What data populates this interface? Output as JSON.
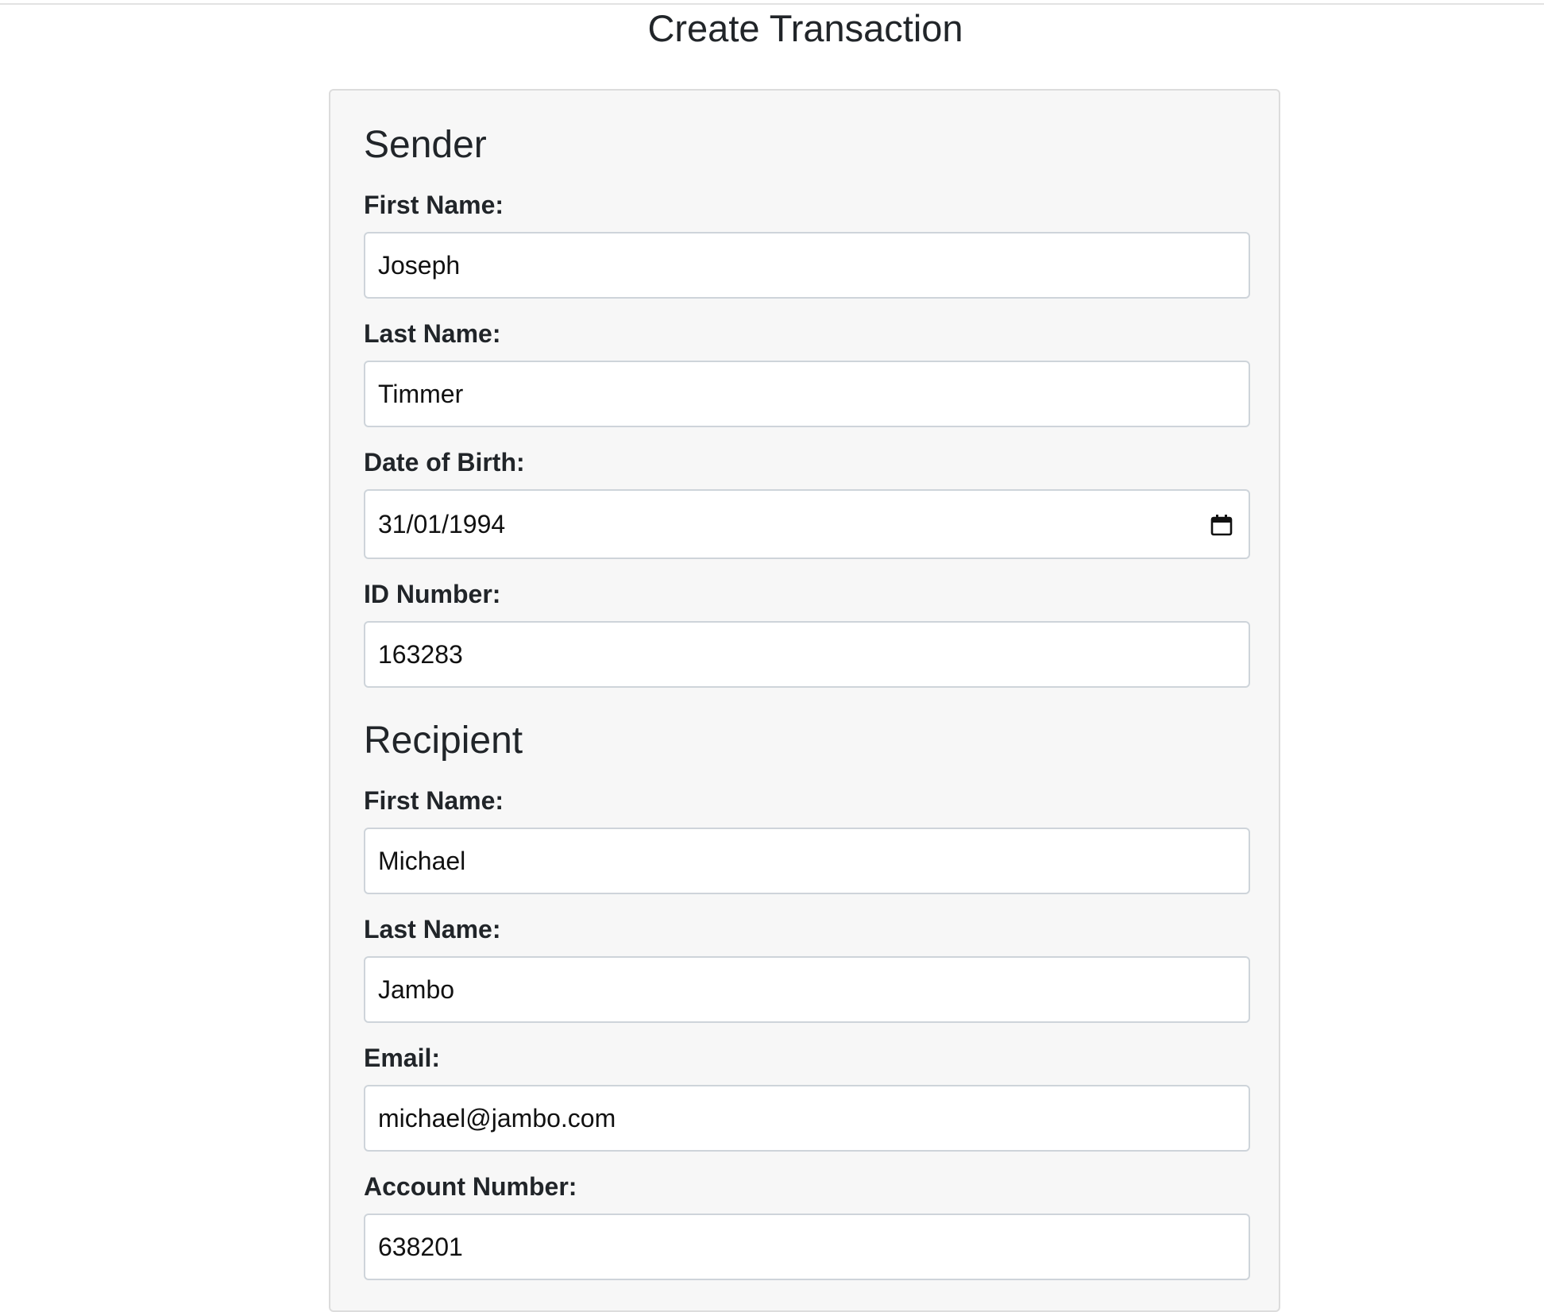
{
  "page": {
    "title": "Create Transaction"
  },
  "sender": {
    "heading": "Sender",
    "first_name": {
      "label": "First Name:",
      "value": "Joseph"
    },
    "last_name": {
      "label": "Last Name:",
      "value": "Timmer"
    },
    "date_of_birth": {
      "label": "Date of Birth:",
      "value": "31/01/1994",
      "icon": "calendar-icon"
    },
    "id_number": {
      "label": "ID Number:",
      "value": "163283"
    }
  },
  "recipient": {
    "heading": "Recipient",
    "first_name": {
      "label": "First Name:",
      "value": "Michael"
    },
    "last_name": {
      "label": "Last Name:",
      "value": "Jambo"
    },
    "email": {
      "label": "Email:",
      "value": "michael@jambo.com"
    },
    "account_number": {
      "label": "Account Number:",
      "value": "638201"
    }
  }
}
